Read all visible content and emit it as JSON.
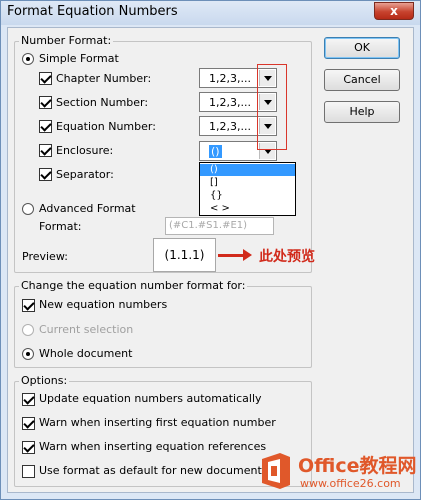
{
  "window": {
    "title": "Format Equation Numbers",
    "close_label": "x"
  },
  "buttons": {
    "ok": "OK",
    "cancel": "Cancel",
    "help": "Help"
  },
  "number_format": {
    "legend": "Number Format:",
    "simple": "Simple Format",
    "advanced": "Advanced Format",
    "format_label": "Format:",
    "format_value": "(#C1.#S1.#E1)",
    "preview_label": "Preview:",
    "preview_value": "(1.1.1)",
    "rows": [
      {
        "label": "Chapter Number:",
        "value": "1,2,3,..."
      },
      {
        "label": "Section Number:",
        "value": "1,2,3,..."
      },
      {
        "label": "Equation Number:",
        "value": "1,2,3,..."
      },
      {
        "label": "Enclosure:",
        "value": "()"
      },
      {
        "label": "Separator:",
        "value": ""
      }
    ],
    "enclosure_options": [
      "()",
      "[]",
      "{}",
      "< >"
    ]
  },
  "change_scope": {
    "legend": "Change the equation number format for:",
    "new_equations": "New equation numbers",
    "current_selection": "Current selection",
    "whole_document": "Whole document"
  },
  "options": {
    "legend": "Options:",
    "items": [
      "Update equation numbers automatically",
      "Warn when inserting first equation number",
      "Warn when inserting equation references",
      "Use format as default for new documents"
    ]
  },
  "annotation": {
    "text": "此处预览",
    "color": "#d12a1b"
  },
  "watermark": {
    "main": "Office教程网",
    "url": "www.office26.com"
  },
  "colors": {
    "selection": "#3399ff",
    "annotation": "#d12a1b",
    "brand": "#e0582a"
  }
}
